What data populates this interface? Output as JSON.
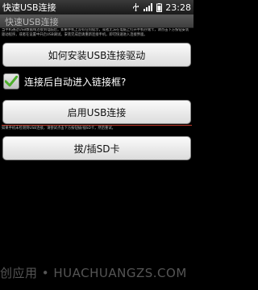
{
  "status_bar": {
    "app_title": "快速USB连接",
    "time": "23:28",
    "icons": [
      "usb-icon",
      "signal-icon",
      "battery-icon"
    ]
  },
  "title_bar": {
    "title": "快速USB连接"
  },
  "description_top": "当手机通过USB数据线连接到电脑后，如果手机上没有任何提示，或者无法在电脑上打开手机存储卡，请点击下方按钮安装驱动程序，或者在设置中开启USB调试。安装完成后请重新连接手机，即可快速进入连接界面。",
  "buttons": {
    "install_driver": "如何安装USB连接驱动",
    "enable_usb": "启用USB连接",
    "unplug_sd": "拔/插SD卡"
  },
  "checkbox": {
    "label": "连接后自动进入链接框?",
    "checked": true
  },
  "description_bottom": "如果手机未检测到USB连接，请尝试点击下方按钮拔/插SD卡，然后重试。",
  "watermark": "创应用 • HUACHUANGZS.COM"
}
